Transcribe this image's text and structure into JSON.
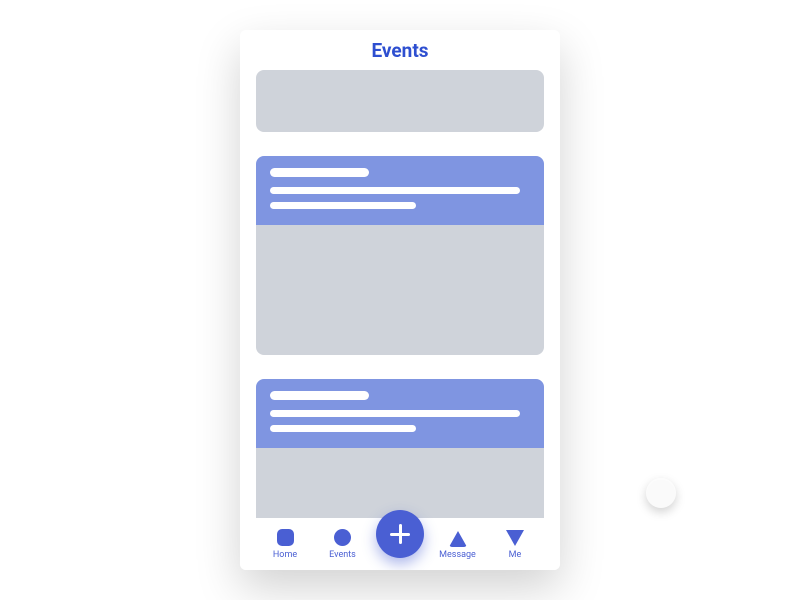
{
  "header": {
    "title": "Events"
  },
  "tabs": {
    "home": {
      "label": "Home"
    },
    "events": {
      "label": "Events"
    },
    "message": {
      "label": "Message"
    },
    "me": {
      "label": "Me"
    }
  },
  "colors": {
    "accent": "#4a5fd3",
    "accent_light": "#7f95e1",
    "placeholder": "#cfd3da",
    "title": "#2e4fd0"
  }
}
